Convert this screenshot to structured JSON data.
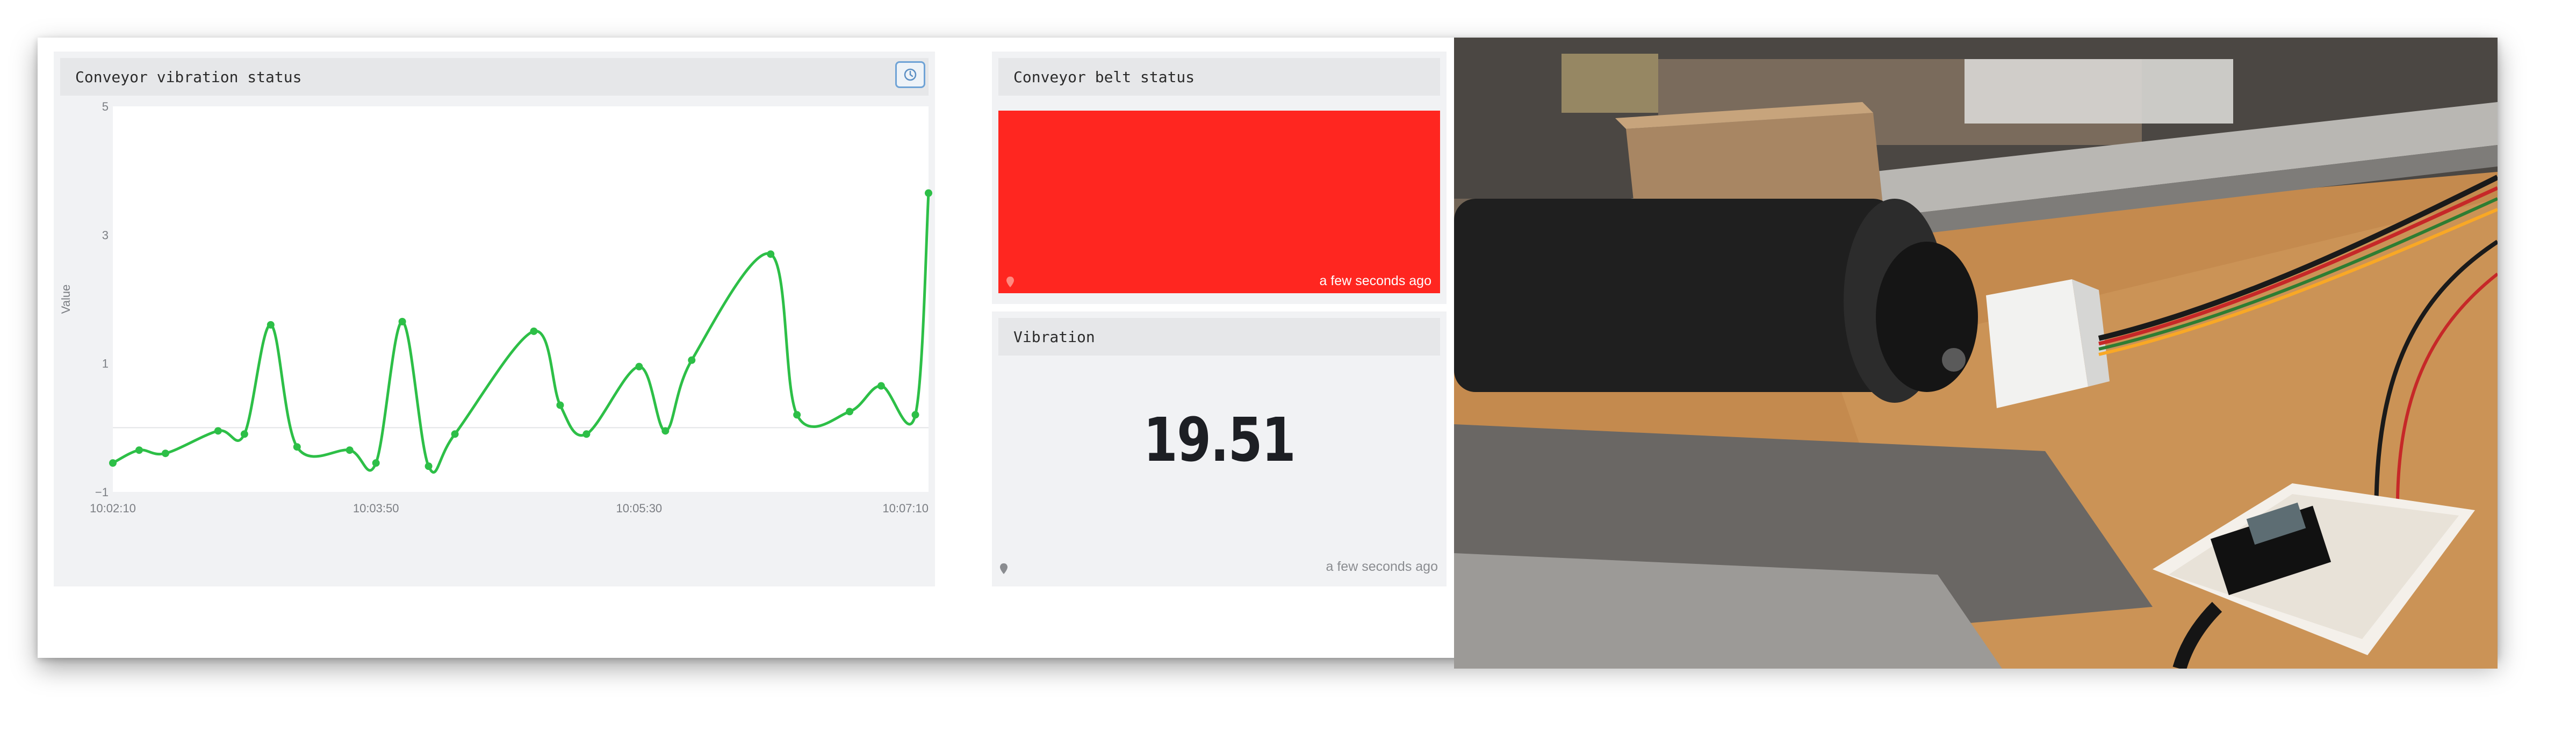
{
  "chart_widget": {
    "title": "Conveyor vibration status",
    "history_icon": "clock-icon"
  },
  "belt_widget": {
    "title": "Conveyor belt status",
    "status_color": "#ff2620",
    "updated": "a few seconds ago"
  },
  "vibration_widget": {
    "title": "Vibration",
    "value": "19.51",
    "updated": "a few seconds ago"
  },
  "colors": {
    "series": "#2dbf47",
    "header": "#e6e7e9",
    "panel": "#f1f2f4"
  },
  "chart_data": {
    "type": "line",
    "title": "Conveyor vibration status",
    "ylabel": "Value",
    "xlabel": "",
    "ylim": [
      -1,
      5
    ],
    "y_ticks": [
      "5",
      "3",
      "1",
      "−1"
    ],
    "x_ticks": [
      "10:02:10",
      "10:03:50",
      "10:05:30",
      "10:07:10"
    ],
    "x_tick_seconds": [
      0,
      100,
      200,
      300
    ],
    "grid": false,
    "legend": "none",
    "series": [
      {
        "x": [
          0,
          10,
          20,
          40,
          50,
          60,
          70,
          90,
          100,
          110,
          120,
          130,
          160,
          170,
          180,
          200,
          210,
          220,
          250,
          260,
          280,
          292,
          305,
          310
        ],
        "y": [
          -0.55,
          -0.35,
          -0.4,
          -0.05,
          -0.1,
          1.6,
          -0.3,
          -0.35,
          -0.55,
          1.65,
          -0.6,
          -0.1,
          1.5,
          0.35,
          -0.1,
          0.95,
          -0.05,
          1.05,
          2.7,
          0.2,
          0.25,
          0.65,
          0.2,
          3.65
        ]
      }
    ]
  }
}
